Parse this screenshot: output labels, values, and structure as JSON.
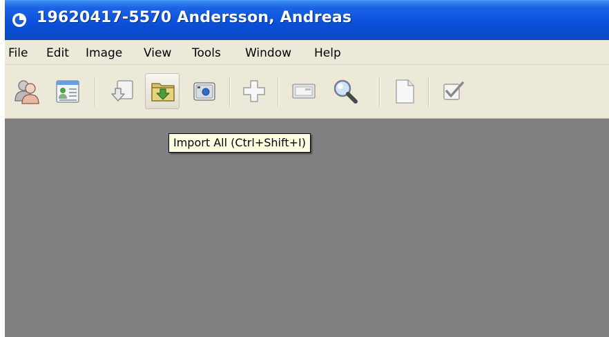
{
  "window": {
    "title": "19620417-5570 Andersson, Andreas",
    "title_bar_color": "#0a4fd8",
    "workspace_color": "#808080"
  },
  "menu": {
    "items": [
      {
        "label": "File"
      },
      {
        "label": "Edit"
      },
      {
        "label": "Image"
      },
      {
        "label": "View"
      },
      {
        "label": "Tools"
      },
      {
        "label": "Window"
      },
      {
        "label": "Help"
      }
    ]
  },
  "toolbar": {
    "buttons": [
      {
        "icon": "patients-icon"
      },
      {
        "icon": "patient-card-icon"
      },
      {
        "icon": "import-icon"
      },
      {
        "icon": "import-all-icon"
      },
      {
        "icon": "camera-icon"
      },
      {
        "icon": "add-icon"
      },
      {
        "icon": "scanner-icon"
      },
      {
        "icon": "magnifier-icon"
      },
      {
        "icon": "document-icon"
      },
      {
        "icon": "checkbox-icon"
      }
    ]
  },
  "tooltip": {
    "text": "Import All (Ctrl+Shift+I)"
  }
}
